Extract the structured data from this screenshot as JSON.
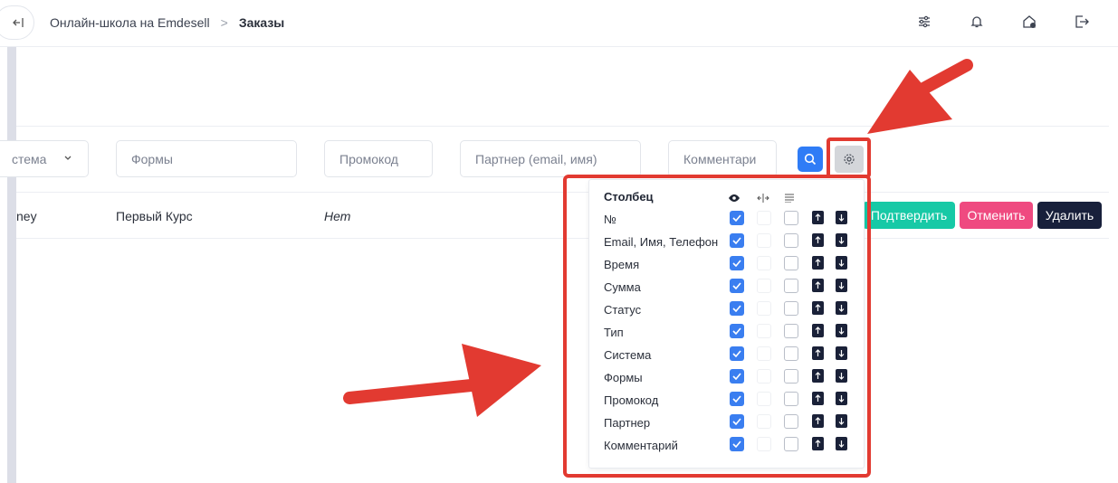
{
  "topbar": {
    "back_icon": "collapse-sidebar-icon",
    "breadcrumb_home": "Онлайн-школа на Emdesell",
    "breadcrumb_sep": ">",
    "breadcrumb_current": "Заказы",
    "icons": [
      "sliders-icon",
      "bell-icon",
      "home-settings-icon",
      "logout-icon"
    ]
  },
  "filters": {
    "system_value": "стема",
    "forms_placeholder": "Формы",
    "promo_placeholder": "Промокод",
    "partner_placeholder": "Партнер (email, имя)",
    "comment_placeholder": "Комментари"
  },
  "row": {
    "col1": "ney",
    "col2": "Первый Курс",
    "col3": "Нет",
    "confirm": "Подтвердить",
    "cancel": "Отменить",
    "delete": "Удалить"
  },
  "columns_popup": {
    "header": "Столбец",
    "header_icons": [
      "eye-icon",
      "column-width-icon",
      "wrap-text-icon"
    ],
    "items": [
      {
        "label": "№",
        "visible": true
      },
      {
        "label": "Email, Имя, Телефон",
        "visible": true
      },
      {
        "label": "Время",
        "visible": true
      },
      {
        "label": "Сумма",
        "visible": true
      },
      {
        "label": "Статус",
        "visible": true
      },
      {
        "label": "Тип",
        "visible": true
      },
      {
        "label": "Система",
        "visible": true
      },
      {
        "label": "Формы",
        "visible": true
      },
      {
        "label": "Промокод",
        "visible": true
      },
      {
        "label": "Партнер",
        "visible": true
      },
      {
        "label": "Комментарий",
        "visible": true
      }
    ]
  },
  "colors": {
    "accent_blue": "#2f7cf6",
    "confirm_green": "#17c9a6",
    "cancel_pink": "#ef4a80",
    "delete_navy": "#18203b",
    "annotation_red": "#e23a31"
  }
}
